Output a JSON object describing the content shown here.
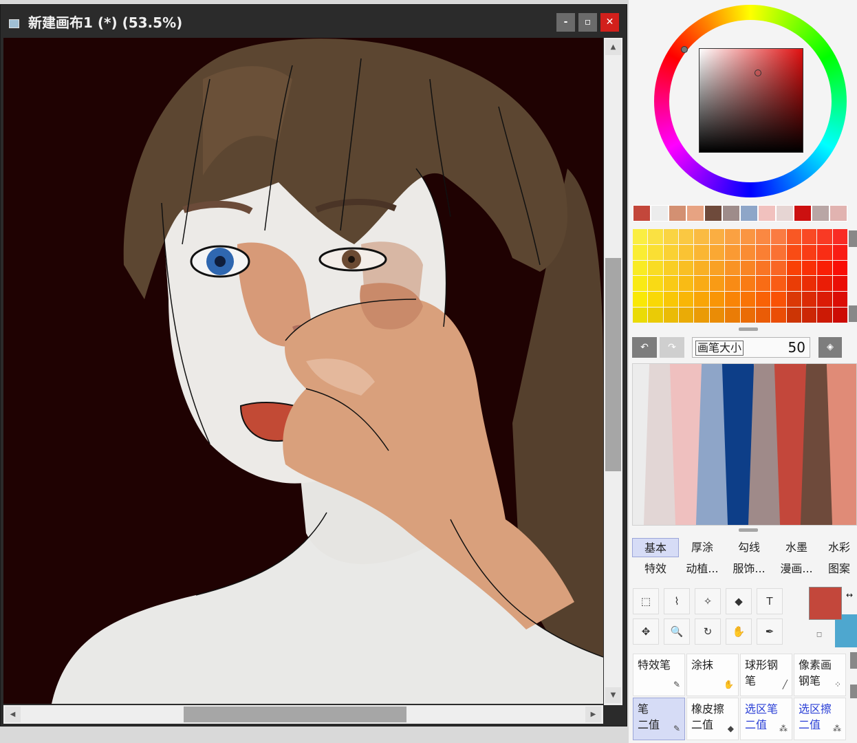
{
  "window": {
    "title": "新建画布1 (*) (53.5%)",
    "minimize": "-",
    "maximize": "▫",
    "close": "✕"
  },
  "scroll": {
    "up": "▲",
    "down": "▼",
    "left": "◀",
    "right": "▶"
  },
  "colors": {
    "main": "#c3473b",
    "sub": "#4ea7cf",
    "canvas_bg": "#1f0202",
    "close_btn": "#d2201c"
  },
  "swatches": [
    "#c3473b",
    "#ececec",
    "#d39072",
    "#e7a382",
    "#6e4a3b",
    "#9e8c8a",
    "#8ea6c8",
    "#f1c1be",
    "#e6d5d3",
    "#cc1010",
    "#b9a6a5",
    "#e1b3b0"
  ],
  "brush_size": {
    "label": "画笔大小",
    "value": "50"
  },
  "stroke_preview": [
    "#e2d6d5",
    "#efc0bf",
    "#8ea5c8",
    "#0d3e88",
    "#9f8a89",
    "#c3473b",
    "#6e4a3b",
    "#e08b77"
  ],
  "undo_icon": "↶",
  "redo_icon": "↷",
  "eraser_icon": "◈",
  "tabs_row1": [
    "基本",
    "厚涂",
    "勾线",
    "水墨",
    "水彩"
  ],
  "tabs_row2": [
    "特效",
    "动植...",
    "服饰...",
    "漫画...",
    "图案"
  ],
  "tools_row1": [
    "⬚",
    "⌇",
    "✧",
    "◆",
    "T"
  ],
  "tools_row2": [
    "✥",
    "🔍",
    "↻",
    "✋",
    "✒"
  ],
  "swap_icon": "↔",
  "reset_icon": "◻",
  "brushes": [
    {
      "label": "特效笔",
      "icon": "✎"
    },
    {
      "label": "涂抹",
      "icon": "✋"
    },
    {
      "label": "球形钢笔",
      "icon": "╱"
    },
    {
      "label": "像素画\n钢笔",
      "icon": "⁘"
    },
    {
      "label": "笔\n二值",
      "icon": "✎"
    },
    {
      "label": "橡皮擦\n二值",
      "icon": "◆"
    },
    {
      "label": "选区笔\n二值",
      "icon": "⁂"
    },
    {
      "label": "选区擦\n二值",
      "icon": "⁂"
    }
  ]
}
